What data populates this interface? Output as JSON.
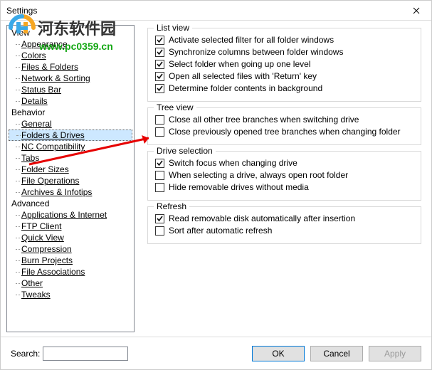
{
  "window": {
    "title": "Settings"
  },
  "watermark": {
    "text": "河东软件园",
    "url": "www.pc0359.cn"
  },
  "tree": {
    "cats": [
      {
        "label": "View",
        "items": [
          "Appearance",
          "Colors",
          "Files & Folders",
          "Network & Sorting",
          "Status Bar",
          "Details"
        ]
      },
      {
        "label": "Behavior",
        "items": [
          "General",
          "Folders & Drives",
          "NC Compatibility",
          "Tabs",
          "Folder Sizes",
          "File Operations",
          "Archives & Infotips"
        ]
      },
      {
        "label": "Advanced",
        "items": [
          "Applications & Internet",
          "FTP Client",
          "Quick View",
          "Compression",
          "Burn Projects",
          "File Associations",
          "Other",
          "Tweaks"
        ]
      }
    ],
    "selected": "Folders & Drives"
  },
  "groups": [
    {
      "title": "List view",
      "items": [
        {
          "label": "Activate selected filter for all folder windows",
          "checked": true
        },
        {
          "label": "Synchronize columns between folder windows",
          "checked": true
        },
        {
          "label": "Select folder when going up one level",
          "checked": true
        },
        {
          "label": "Open all selected files with 'Return' key",
          "checked": true
        },
        {
          "label": "Determine folder contents in background",
          "checked": true
        }
      ]
    },
    {
      "title": "Tree view",
      "items": [
        {
          "label": "Close all other tree branches when switching drive",
          "checked": false
        },
        {
          "label": "Close previously opened tree branches when changing folder",
          "checked": false
        }
      ]
    },
    {
      "title": "Drive selection",
      "items": [
        {
          "label": "Switch focus when changing drive",
          "checked": true
        },
        {
          "label": "When selecting a drive, always open root folder",
          "checked": false
        },
        {
          "label": "Hide removable drives without media",
          "checked": false
        }
      ]
    },
    {
      "title": "Refresh",
      "items": [
        {
          "label": "Read removable disk automatically after insertion",
          "checked": true
        },
        {
          "label": "Sort after automatic refresh",
          "checked": false
        }
      ]
    }
  ],
  "footer": {
    "search_label": "Search:",
    "search_value": "",
    "ok": "OK",
    "cancel": "Cancel",
    "apply": "Apply"
  }
}
